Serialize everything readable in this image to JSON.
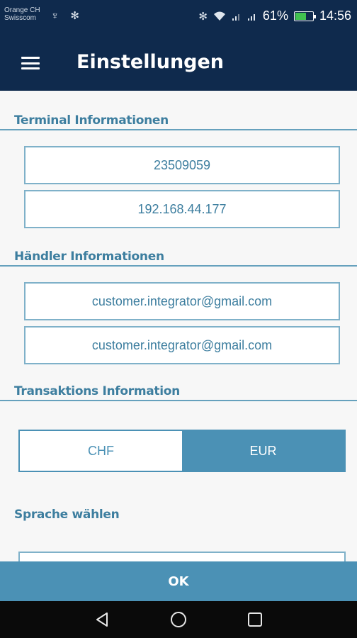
{
  "status_bar": {
    "carrier_line1": "Orange CH",
    "carrier_line2": "Swisscom",
    "left_icons": "♆ ✻",
    "battery_percent": "61%",
    "time": "14:56",
    "battery_level": 0.61
  },
  "app_bar": {
    "title": "Einstellungen",
    "menu_icon": "hamburger-menu-icon"
  },
  "sections": {
    "terminal": {
      "title": "Terminal Informationen",
      "terminal_id": "23509059",
      "ip_address": "192.168.44.177"
    },
    "merchant": {
      "title": "Händler Informationen",
      "email1": "customer.integrator@gmail.com",
      "email2": "customer.integrator@gmail.com"
    },
    "transaction": {
      "title": "Transaktions Information",
      "currency_options": [
        "CHF",
        "EUR"
      ],
      "selected_currency": "EUR"
    },
    "language": {
      "title": "Sprache wählen"
    }
  },
  "ok_button_label": "OK",
  "colors": {
    "header_bg": "#0f2a4d",
    "accent": "#4b91b5",
    "section_text": "#3d7e9f"
  }
}
